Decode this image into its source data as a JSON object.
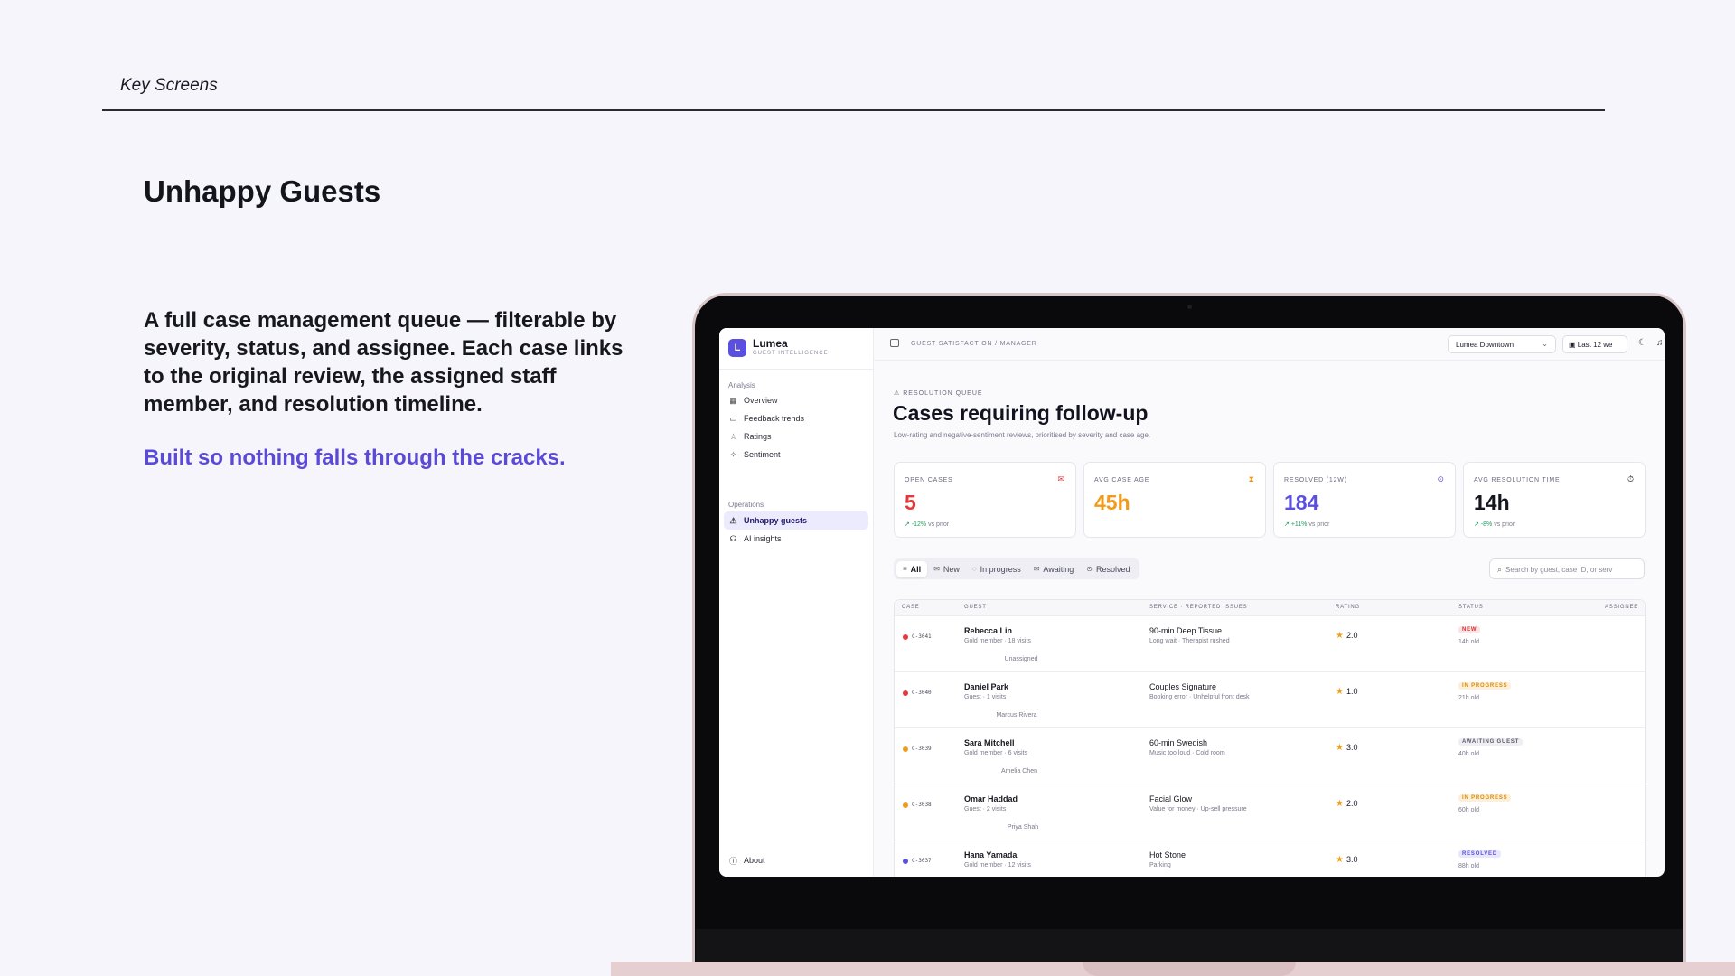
{
  "slide": {
    "header": "Key Screens",
    "title": "Unhappy Guests",
    "body": "A full case management queue — filterable by severity, status, and assignee. Each case links to the original review, the assigned staff member, and resolution timeline.",
    "tagline": "Built so nothing falls through the cracks."
  },
  "app": {
    "brand": {
      "logo": "L",
      "name": "Lumea",
      "subtitle": "GUEST INTELLIGENCE"
    },
    "sidebar": {
      "analysis_label": "Analysis",
      "analysis_items": [
        {
          "label": "Overview",
          "icon": "grid-icon"
        },
        {
          "label": "Feedback trends",
          "icon": "chat-icon"
        },
        {
          "label": "Ratings",
          "icon": "star-icon"
        },
        {
          "label": "Sentiment",
          "icon": "sparkle-icon"
        }
      ],
      "operations_label": "Operations",
      "operations_items": [
        {
          "label": "Unhappy guests",
          "icon": "warning-icon",
          "active": true
        },
        {
          "label": "AI insights",
          "icon": "brain-icon"
        }
      ],
      "about_label": "About"
    },
    "topbar": {
      "breadcrumb": "GUEST SATISFACTION / MANAGER",
      "location": "Lumea Downtown",
      "date_range": "Last 12 we"
    },
    "main": {
      "eyebrow": "RESOLUTION QUEUE",
      "title": "Cases requiring follow-up",
      "subtitle": "Low-rating and negative-sentiment reviews, prioritised by severity and case age."
    },
    "kpis": [
      {
        "label": "OPEN CASES",
        "value": "5",
        "delta": "-12%",
        "delta_suffix": "vs prior",
        "color": "#e5383b",
        "icon": "inbox-icon"
      },
      {
        "label": "AVG CASE AGE",
        "value": "45h",
        "delta": null,
        "delta_suffix": null,
        "color": "#f29a1a",
        "icon": "hourglass-icon"
      },
      {
        "label": "RESOLVED (12W)",
        "value": "184",
        "delta": "+11%",
        "delta_suffix": "vs prior",
        "color": "#5b4fe0",
        "icon": "check-circle-icon"
      },
      {
        "label": "AVG RESOLUTION TIME",
        "value": "14h",
        "delta": "-8%",
        "delta_suffix": "vs prior",
        "color": "#16161f",
        "icon": "timer-icon"
      }
    ],
    "tabs": [
      {
        "label": "All",
        "active": true
      },
      {
        "label": "New"
      },
      {
        "label": "In progress"
      },
      {
        "label": "Awaiting"
      },
      {
        "label": "Resolved"
      }
    ],
    "search": {
      "placeholder": "Search by guest, case ID, or serv"
    },
    "table": {
      "columns": [
        "CASE",
        "GUEST",
        "SERVICE · REPORTED ISSUES",
        "RATING",
        "STATUS",
        "ASSIGNEE"
      ],
      "rows": [
        {
          "case": "C-3041",
          "severity_color": "#e5383b",
          "guest": "Rebecca Lin",
          "meta": "Gold member · 18 visits",
          "service": "90-min Deep Tissue",
          "issues": "Long wait · Therapist rushed",
          "rating": "2.0",
          "status": "NEW",
          "status_bg": "#fde4e4",
          "status_fg": "#d62f32",
          "age": "14h old",
          "assignee": "Unassigned"
        },
        {
          "case": "C-3040",
          "severity_color": "#e5383b",
          "guest": "Daniel Park",
          "meta": "Guest · 1 visits",
          "service": "Couples Signature",
          "issues": "Booking error · Unhelpful front desk",
          "rating": "1.0",
          "status": "IN PROGRESS",
          "status_bg": "#fdf0d8",
          "status_fg": "#d88a0c",
          "age": "21h old",
          "assignee": "Marcus Rivera"
        },
        {
          "case": "C-3039",
          "severity_color": "#f29a1a",
          "guest": "Sara Mitchell",
          "meta": "Gold member · 6 visits",
          "service": "60-min Swedish",
          "issues": "Music too loud · Cold room",
          "rating": "3.0",
          "status": "AWAITING GUEST",
          "status_bg": "#eeeef3",
          "status_fg": "#5a5a6a",
          "age": "40h old",
          "assignee": "Amelia Chen"
        },
        {
          "case": "C-3038",
          "severity_color": "#f29a1a",
          "guest": "Omar Haddad",
          "meta": "Guest · 2 visits",
          "service": "Facial Glow",
          "issues": "Value for money · Up-sell pressure",
          "rating": "2.0",
          "status": "IN PROGRESS",
          "status_bg": "#fdf0d8",
          "status_fg": "#d88a0c",
          "age": "60h old",
          "assignee": "Priya Shah"
        },
        {
          "case": "C-3037",
          "severity_color": "#5b4fe0",
          "guest": "Hana Yamada",
          "meta": "Gold member · 12 visits",
          "service": "Hot Stone",
          "issues": "Parking",
          "rating": "3.0",
          "status": "RESOLVED",
          "status_bg": "#e9e7fc",
          "status_fg": "#5b4fe0",
          "age": "88h old",
          "assignee": ""
        }
      ]
    }
  }
}
